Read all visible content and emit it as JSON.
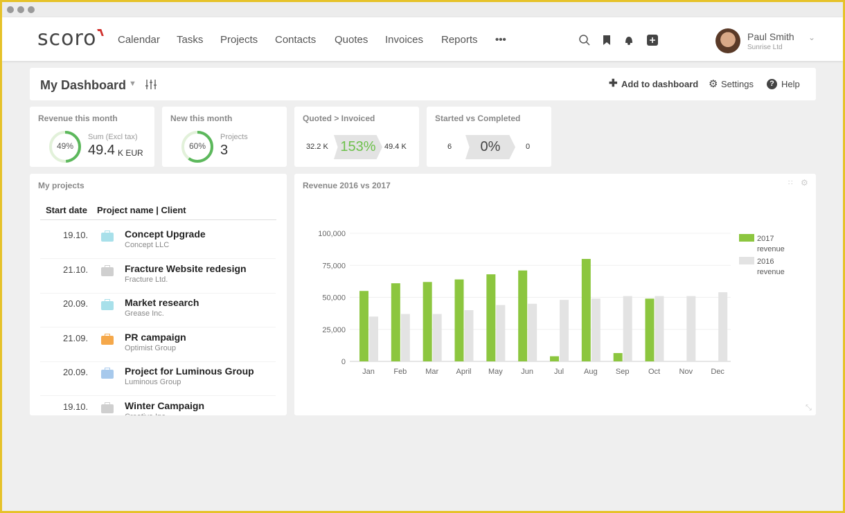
{
  "nav": {
    "logo": "scoro",
    "items": [
      "Calendar",
      "Tasks",
      "Projects",
      "Contacts",
      "Quotes",
      "Invoices",
      "Reports",
      "•••"
    ],
    "icons": [
      "search-icon",
      "bookmark-icon",
      "notification-bell-icon",
      "add-icon"
    ],
    "user": {
      "name": "Paul Smith",
      "company": "Sunrise Ltd"
    }
  },
  "dashboard": {
    "title": "My Dashboard",
    "add": "Add to dashboard",
    "settings": "Settings",
    "help": "Help"
  },
  "kpis": [
    {
      "title": "Revenue this month",
      "percent": "49%",
      "percent_value": 49,
      "label": "Sum (Excl tax)",
      "value": "49.4",
      "unit": "K EUR"
    },
    {
      "title": "New this month",
      "percent": "60%",
      "percent_value": 60,
      "label": "Projects",
      "value": "3"
    },
    {
      "title": "Quoted > Invoiced",
      "left": "32.2 K",
      "center": "153%",
      "right": "49.4 K"
    },
    {
      "title": "Started vs Completed",
      "left": "6",
      "center": "0%",
      "right": "0"
    }
  ],
  "projects": {
    "title": "My projects",
    "headers": [
      "Start date",
      "Project name | Client"
    ],
    "rows": [
      {
        "date": "19.10.",
        "name": "Concept Upgrade",
        "client": "Concept LLC",
        "color": "#a8e0ea"
      },
      {
        "date": "21.10.",
        "name": "Fracture Website redesign",
        "client": "Fracture Ltd.",
        "color": "#cfcfcf"
      },
      {
        "date": "20.09.",
        "name": "Market research",
        "client": "Grease Inc.",
        "color": "#a8e0ea"
      },
      {
        "date": "21.09.",
        "name": "PR campaign",
        "client": "Optimist Group",
        "color": "#f5a84a"
      },
      {
        "date": "20.09.",
        "name": "Project for Luminous Group",
        "client": "Luminous Group",
        "color": "#a7c9ec"
      },
      {
        "date": "19.10.",
        "name": "Winter Campaign",
        "client": "Creative Inc.",
        "color": "#cfcfcf"
      }
    ]
  },
  "chart_data": {
    "type": "bar",
    "title": "Revenue 2016 vs 2017",
    "categories": [
      "Jan",
      "Feb",
      "Mar",
      "April",
      "May",
      "Jun",
      "Jul",
      "Aug",
      "Sep",
      "Oct",
      "Nov",
      "Dec"
    ],
    "series": [
      {
        "name": "2017 revenue",
        "color": "#8cc63f",
        "values": [
          55000,
          61000,
          62000,
          64000,
          68000,
          71000,
          4000,
          80000,
          6500,
          49000,
          0,
          0
        ]
      },
      {
        "name": "2016 revenue",
        "color": "#e3e3e3",
        "values": [
          35000,
          37000,
          37000,
          40000,
          44000,
          45000,
          48000,
          49000,
          51000,
          51000,
          51000,
          54000
        ]
      }
    ],
    "ylim": [
      0,
      100000
    ],
    "yticks": [
      "0",
      "25,000",
      "50,000",
      "75,000",
      "100,000"
    ],
    "grid": true,
    "legend": "right"
  }
}
